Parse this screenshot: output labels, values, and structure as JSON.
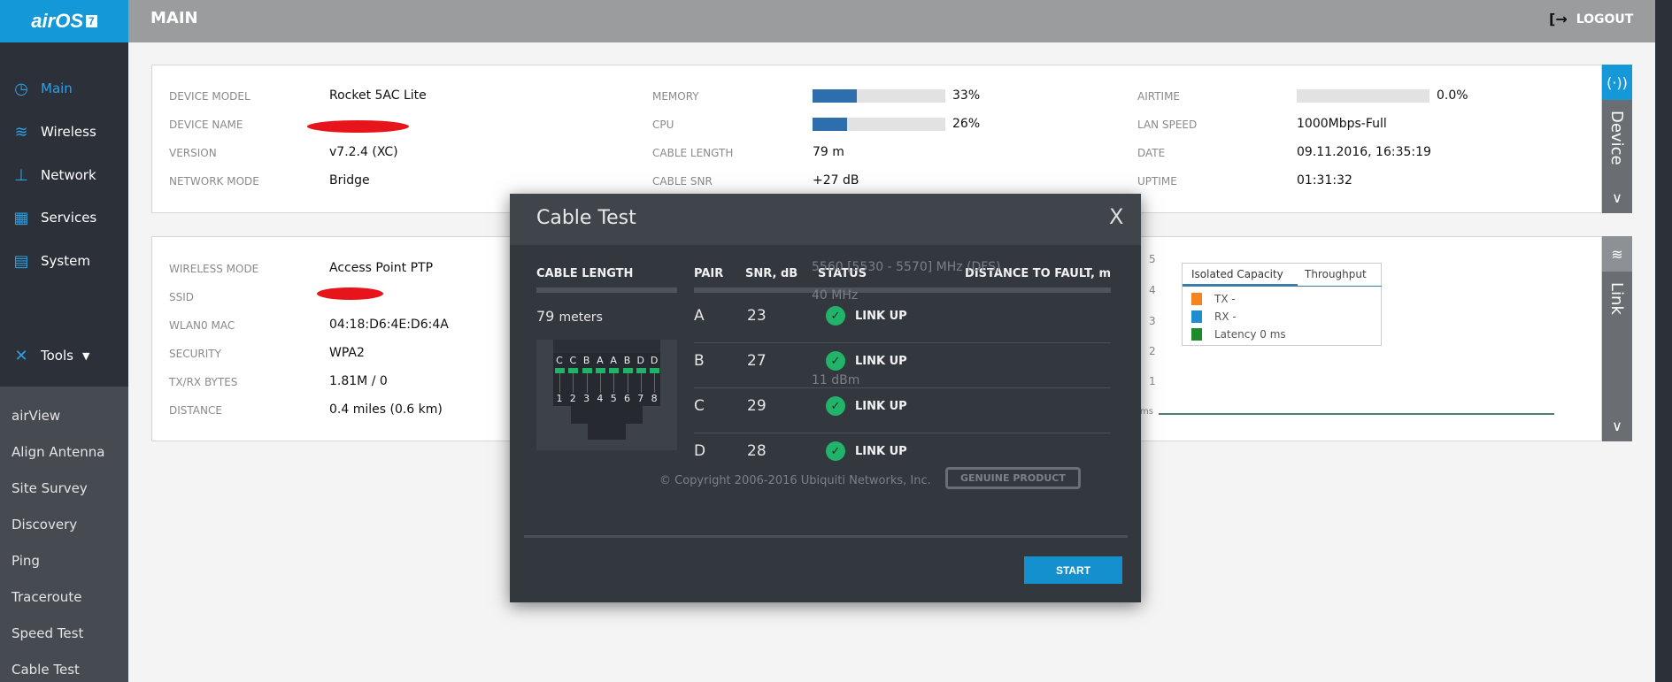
{
  "app": {
    "logo": "airOS",
    "logo_version": "7",
    "page_title": "MAIN",
    "logout": "LOGOUT"
  },
  "sidebar": {
    "items": [
      {
        "label": "Main",
        "icon": "dashboard-icon"
      },
      {
        "label": "Wireless",
        "icon": "wifi-icon"
      },
      {
        "label": "Network",
        "icon": "network-icon"
      },
      {
        "label": "Services",
        "icon": "services-icon"
      },
      {
        "label": "System",
        "icon": "system-chip-icon"
      }
    ],
    "tools": {
      "label": "Tools",
      "items": [
        "airView",
        "Align Antenna",
        "Site Survey",
        "Discovery",
        "Ping",
        "Traceroute",
        "Speed Test",
        "Cable Test"
      ]
    }
  },
  "device": {
    "tab": "Device",
    "col1": [
      {
        "label": "DEVICE MODEL",
        "value": "Rocket 5AC Lite"
      },
      {
        "label": "DEVICE NAME",
        "value": ""
      },
      {
        "label": "VERSION",
        "value": "v7.2.4 (XC)"
      },
      {
        "label": "NETWORK MODE",
        "value": "Bridge"
      }
    ],
    "col2": {
      "memory": {
        "label": "MEMORY",
        "value": "33%",
        "percent": 33
      },
      "cpu": {
        "label": "CPU",
        "value": "26%",
        "percent": 26
      },
      "cable_length": {
        "label": "CABLE LENGTH",
        "value": "79 m"
      },
      "cable_snr": {
        "label": "CABLE SNR",
        "value": "+27 dB"
      }
    },
    "col3": {
      "airtime": {
        "label": "AIRTIME",
        "value": "0.0%",
        "percent": 0
      },
      "lan_speed": {
        "label": "LAN SPEED",
        "value": "1000Mbps-Full"
      },
      "date": {
        "label": "DATE",
        "value": "09.11.2016, 16:35:19"
      },
      "uptime": {
        "label": "UPTIME",
        "value": "01:31:32"
      }
    }
  },
  "link": {
    "tab": "Link",
    "col1": [
      {
        "label": "WIRELESS MODE",
        "value": "Access Point PTP"
      },
      {
        "label": "SSID",
        "value": ""
      },
      {
        "label": "WLAN0 MAC",
        "value": "04:18:D6:4E:D6:4A"
      },
      {
        "label": "SECURITY",
        "value": "WPA2"
      },
      {
        "label": "TX/RX BYTES",
        "value": "1.81M / 0"
      },
      {
        "label": "DISTANCE",
        "value": "0.4 miles (0.6 km)"
      }
    ],
    "background_values": [
      "5560 [5530 - 5570] MHz (DFS)",
      "40 MHz",
      "11 dBm"
    ],
    "chart": {
      "y_ticks": [
        "5",
        "4",
        "3",
        "2",
        "1"
      ],
      "unit": "ms",
      "tabs": [
        "Isolated Capacity",
        "Throughput"
      ],
      "active_tab": "Isolated Capacity",
      "legend": [
        {
          "label": "TX -",
          "color": "#f5841f"
        },
        {
          "label": "RX -",
          "color": "#1f8dd0"
        },
        {
          "label": "Latency 0 ms",
          "color": "#1d8a2b"
        }
      ]
    }
  },
  "footer": {
    "copyright": "© Copyright 2006-2016 Ubiquiti Networks, Inc.",
    "badge": "GENUINE PRODUCT"
  },
  "modal": {
    "title": "Cable Test",
    "close": "X",
    "cable_length_header": "CABLE LENGTH",
    "cable_length_value": "79",
    "cable_length_unit": "meters",
    "connector": {
      "pairs": [
        "C",
        "C",
        "B",
        "A",
        "A",
        "B",
        "D",
        "D"
      ],
      "pins": [
        "1",
        "2",
        "3",
        "4",
        "5",
        "6",
        "7",
        "8"
      ]
    },
    "headers": {
      "pair": "PAIR",
      "snr": "SNR, dB",
      "status": "STATUS",
      "distance": "DISTANCE TO FAULT, m"
    },
    "rows": [
      {
        "pair": "A",
        "snr": "23",
        "status": "LINK UP",
        "distance": ""
      },
      {
        "pair": "B",
        "snr": "27",
        "status": "LINK UP",
        "distance": ""
      },
      {
        "pair": "C",
        "snr": "29",
        "status": "LINK UP",
        "distance": ""
      },
      {
        "pair": "D",
        "snr": "28",
        "status": "LINK UP",
        "distance": ""
      }
    ],
    "start": "START",
    "status_color": "#21b36a"
  }
}
